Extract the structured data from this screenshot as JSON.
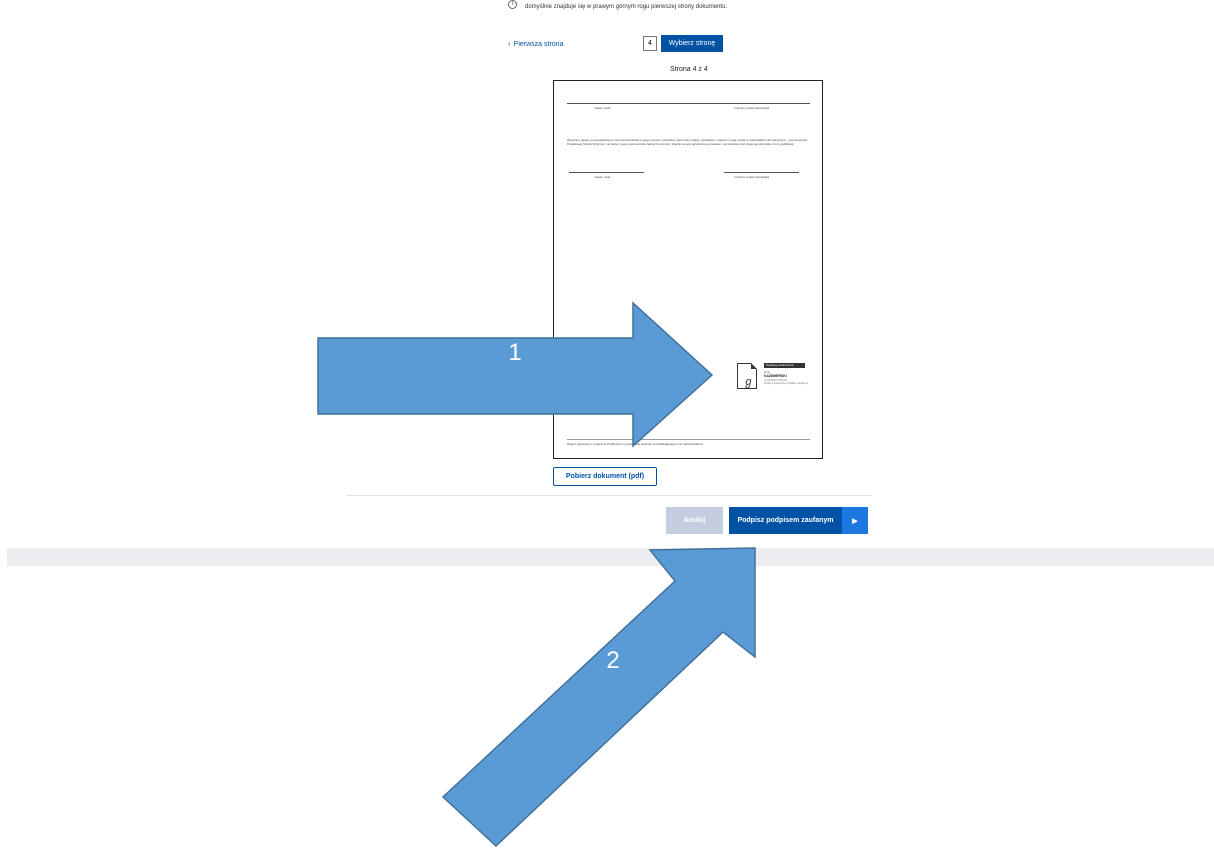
{
  "info": {
    "icon": "info-icon",
    "text": "domyślnie znajduje się w prawym górnym rogu pierwszej strony dokumentu."
  },
  "pager": {
    "first_page_label": "Pierwsza strona",
    "page_value": "4",
    "select_page_label": "Wybierz stronę",
    "page_counter": "Strona 4 z 4"
  },
  "document": {
    "place_date_1": "miasto, data",
    "candidate_signature_1": "czytelny podpis kandydata",
    "paragraph": "Wyrażam zgodę na nieodpłatnego rozpowszechniania mojego imienia i nazwiska, wizerunku (zdjęć), wywiadów i nagrań z moją osobą w materiałach informacyjnych – promocyjnych Powiatowej Szkoły Wyższej i nie będą z tego tytułu wnosiła żadnych roszczeń. Zgoda nie jest ograniczona czasowo i terytorialnie oraz obejmuje wszystkie formy publikacji.",
    "place_date_2": "miasto, data",
    "candidate_signature_2": "czytelny podpis kandydata",
    "signature": {
      "label": "Podpisany elektronicznie",
      "name_prefix": "Anna",
      "name": "KAZIMIERSKI",
      "meta_1": "21.06.2023 12:55:34",
      "meta_2": "Podpis potwierdzony profilem zaufanym"
    },
    "footer": "Raport wykonany z programu ProMonitor na podstawie wniosku umożliwiającego przez administratora"
  },
  "actions": {
    "download_label": "Pobierz dokument (pdf)",
    "cancel_label": "Anuluj",
    "sign_label": "Podpisz podpisem zaufanym",
    "sign_arrow_icon": "triangle-right-icon"
  },
  "annotations": {
    "arrow_1_label": "1",
    "arrow_2_label": "2",
    "arrow_color": "#5b9bd5",
    "arrow_stroke": "#41719c"
  },
  "colors": {
    "primary": "#0052a5",
    "primary_light": "#1c78e0",
    "cancel_bg": "#c4cede",
    "band_bg": "#ebedf1"
  }
}
